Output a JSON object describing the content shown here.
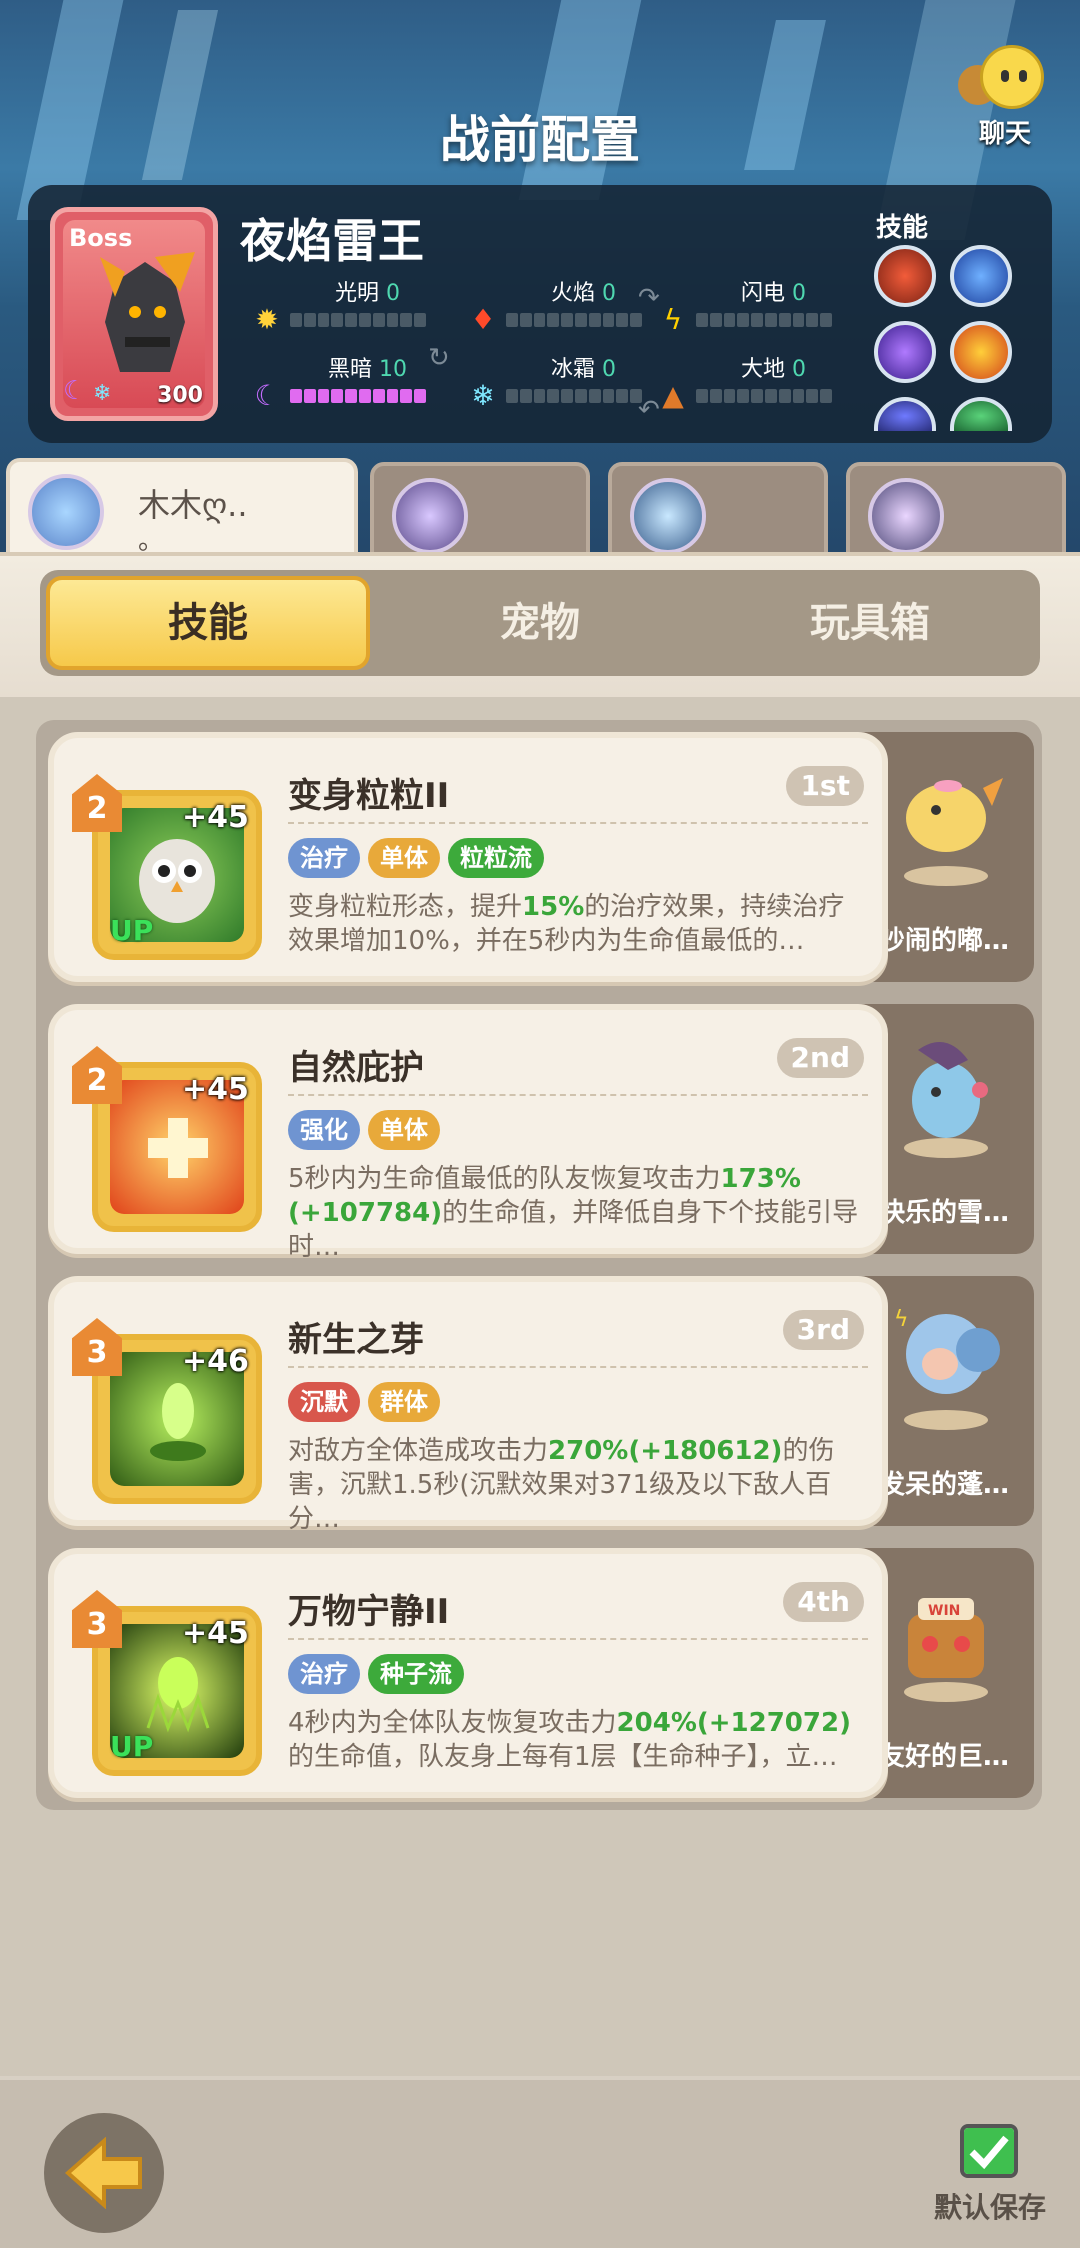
{
  "header": {
    "title": "战前配置",
    "chat_label": "聊天"
  },
  "boss": {
    "tag": "Boss",
    "name": "夜焰雷王",
    "level": "300",
    "attributes": [
      {
        "label": "光明",
        "value": "0",
        "icon": "sun-icon"
      },
      {
        "label": "火焰",
        "value": "0",
        "icon": "fire-icon"
      },
      {
        "label": "闪电",
        "value": "0",
        "icon": "lightning-icon"
      },
      {
        "label": "黑暗",
        "value": "10",
        "icon": "moon-icon"
      },
      {
        "label": "冰霜",
        "value": "0",
        "icon": "snowflake-icon"
      },
      {
        "label": "大地",
        "value": "0",
        "icon": "earth-icon"
      }
    ],
    "skills_label": "技能"
  },
  "players": [
    {
      "name": "木木ღ..",
      "sub": "。"
    }
  ],
  "tabs": [
    "技能",
    "宠物",
    "玩具箱"
  ],
  "cards": [
    {
      "level": "2",
      "plus": "+45",
      "up": "UP",
      "name": "变身粒粒II",
      "rank": "1st",
      "tags": [
        {
          "t": "治疗",
          "c": "blue"
        },
        {
          "t": "单体",
          "c": "orange"
        },
        {
          "t": "粒粒流",
          "c": "green"
        }
      ],
      "desc": [
        "变身粒粒形态，提升",
        "15%",
        "的治疗效果，持续治疗效果增加10%，并在5秒内为生命值最低的…"
      ],
      "pet": "吵闹的嘟…"
    },
    {
      "level": "2",
      "plus": "+45",
      "up": "",
      "name": "自然庇护",
      "rank": "2nd",
      "tags": [
        {
          "t": "强化",
          "c": "blue"
        },
        {
          "t": "单体",
          "c": "orange"
        }
      ],
      "desc": [
        "5秒内为生命值最低的队友恢复攻击力",
        "173%(+107784)",
        "的生命值，并降低自身下个技能引导时…"
      ],
      "pet": "快乐的雪…"
    },
    {
      "level": "3",
      "plus": "+46",
      "up": "",
      "name": "新生之芽",
      "rank": "3rd",
      "tags": [
        {
          "t": "沉默",
          "c": "red"
        },
        {
          "t": "群体",
          "c": "orange"
        }
      ],
      "desc": [
        "对敌方全体造成攻击力",
        "270%(+180612)",
        "的伤害，沉默1.5秒(沉默效果对371级及以下敌人百分…"
      ],
      "pet": "发呆的蓬…"
    },
    {
      "level": "3",
      "plus": "+45",
      "up": "UP",
      "name": "万物宁静II",
      "rank": "4th",
      "tags": [
        {
          "t": "治疗",
          "c": "blue"
        },
        {
          "t": "种子流",
          "c": "green"
        }
      ],
      "desc": [
        "4秒内为全体队友恢复攻击力",
        "204%(+127072)",
        "的生命值，队友身上每有1层【生命种子】，立…"
      ],
      "pet": "友好的巨…"
    }
  ],
  "footer": {
    "save_label": "默认保存"
  }
}
